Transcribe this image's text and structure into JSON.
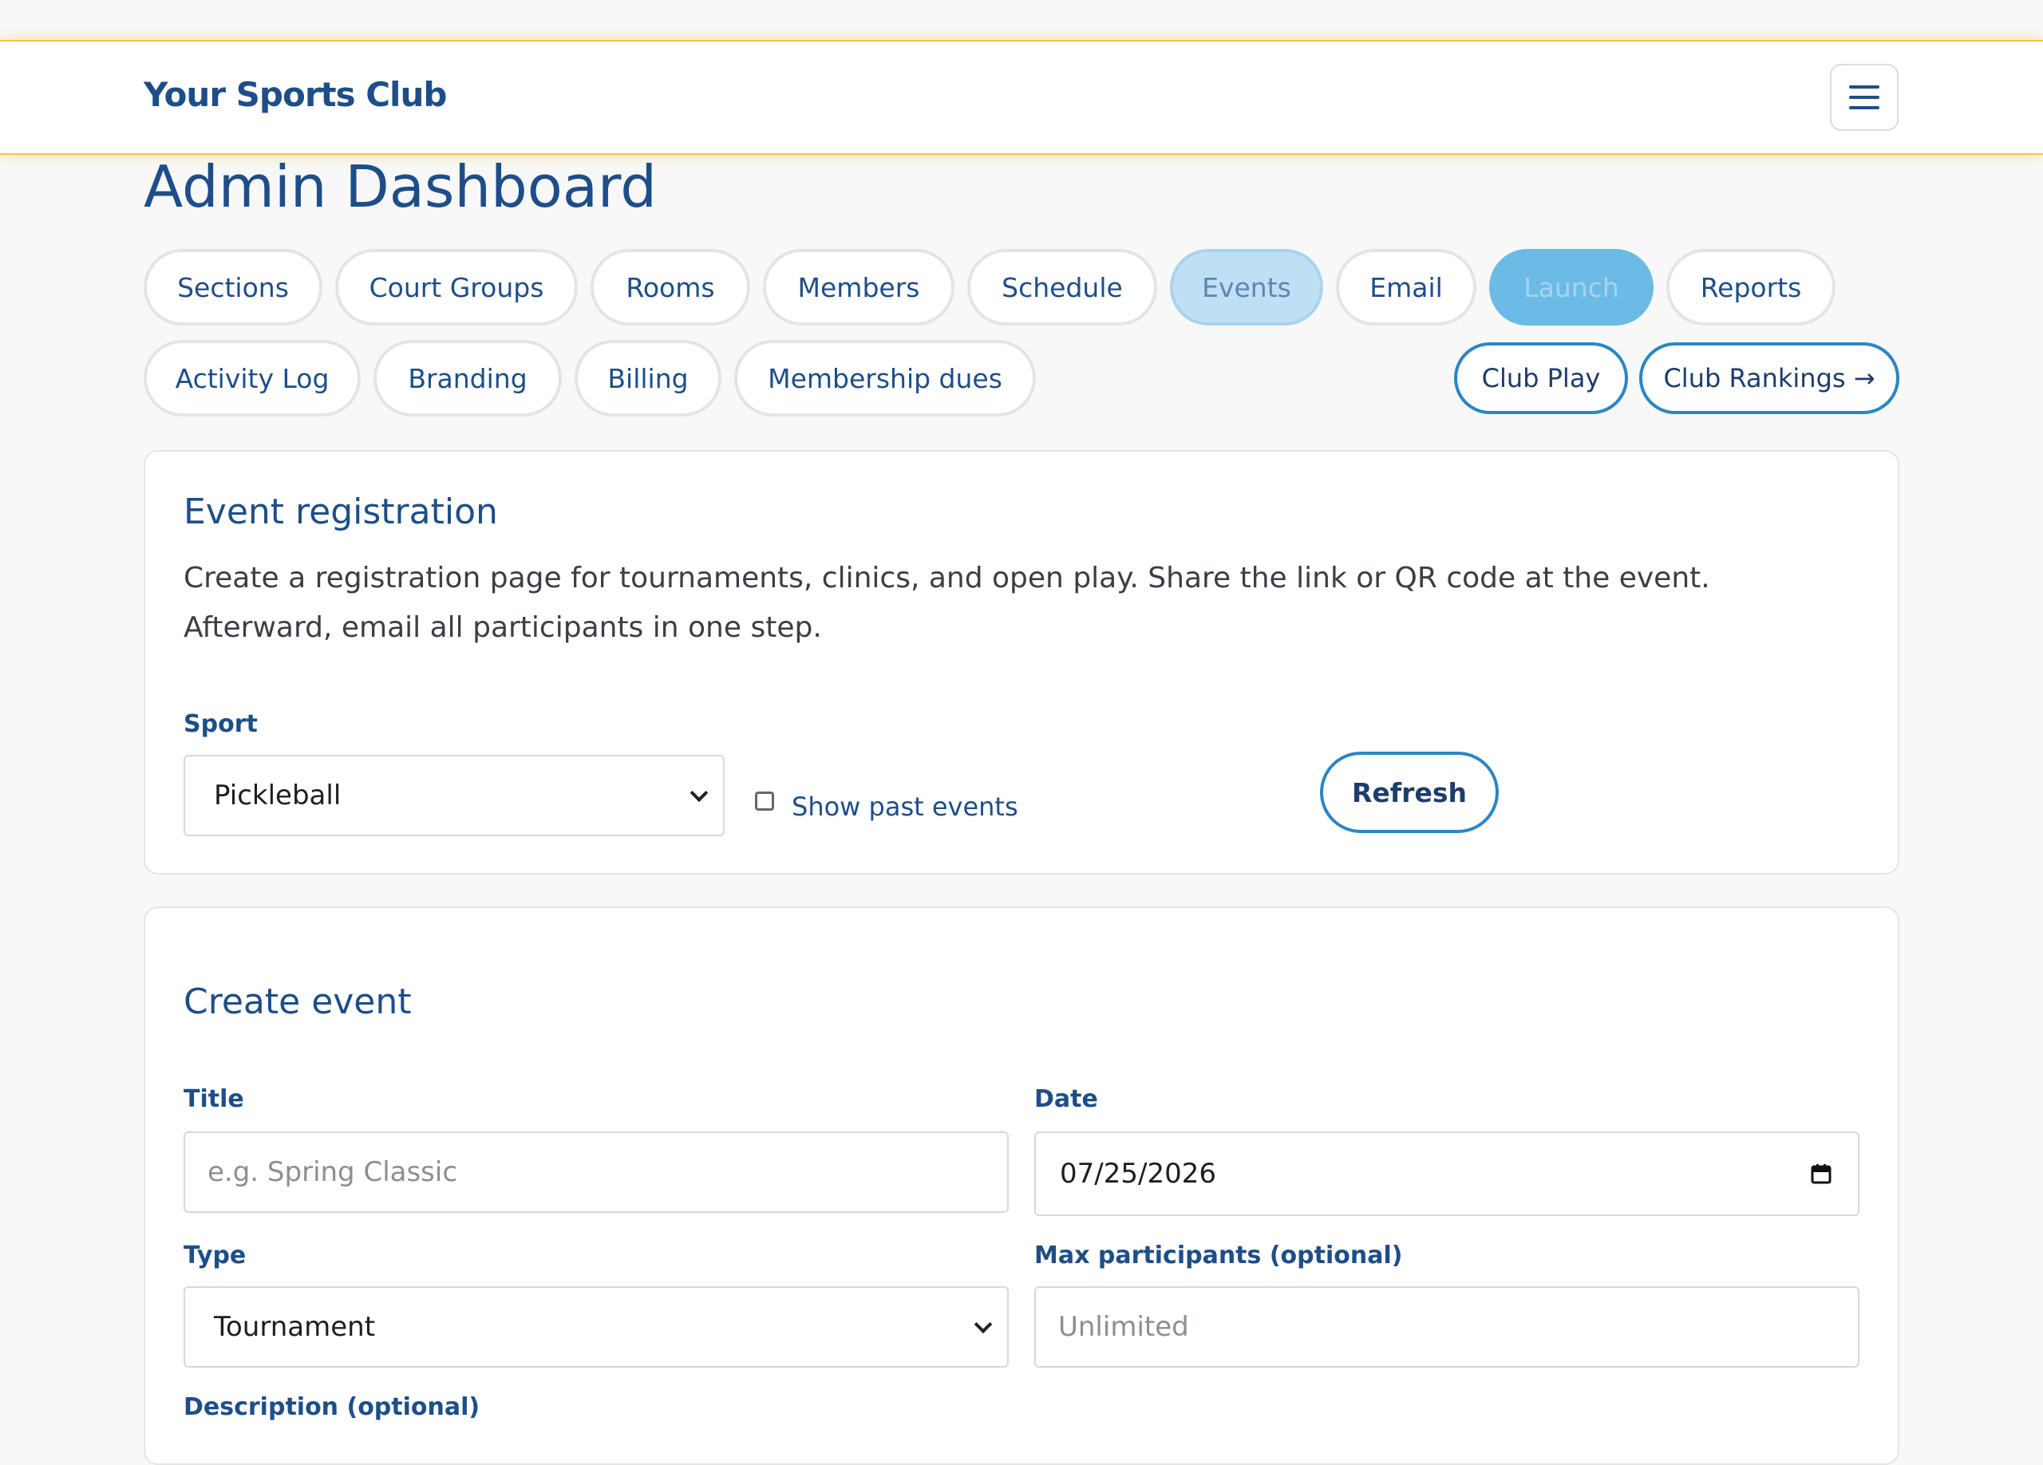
{
  "header": {
    "brand": "Your Sports Club",
    "menu_icon": "hamburger-menu-icon"
  },
  "page": {
    "title": "Admin Dashboard"
  },
  "nav": {
    "tabs": [
      {
        "label": "Sections"
      },
      {
        "label": "Court Groups"
      },
      {
        "label": "Rooms"
      },
      {
        "label": "Members"
      },
      {
        "label": "Schedule"
      },
      {
        "label": "Events",
        "state": "active"
      },
      {
        "label": "Email"
      },
      {
        "label": "Launch",
        "state": "highlight"
      },
      {
        "label": "Reports"
      },
      {
        "label": "Activity Log"
      },
      {
        "label": "Branding"
      },
      {
        "label": "Billing"
      },
      {
        "label": "Membership dues"
      }
    ],
    "club_play": "Club Play",
    "club_rankings": "Club Rankings →"
  },
  "registration": {
    "title": "Event registration",
    "description": "Create a registration page for tournaments, clinics, and open play. Share the link or QR code at the event. Afterward, email all participants in one step.",
    "sport_label": "Sport",
    "sport_value": "Pickleball",
    "show_past_label": "Show past events",
    "show_past_checked": false,
    "refresh_label": "Refresh"
  },
  "create": {
    "title": "Create event",
    "title_label": "Title",
    "title_placeholder": "e.g. Spring Classic",
    "date_label": "Date",
    "date_value": "07/25/2026",
    "type_label": "Type",
    "type_value": "Tournament",
    "max_label": "Max participants (optional)",
    "max_placeholder": "Unlimited",
    "description_label": "Description (optional)"
  },
  "colors": {
    "brand": "#1d4e89",
    "accent_border": "#f5c842",
    "active_tab": "#bfe0f4",
    "launch_tab": "#6cbbe6",
    "outline_button": "#2a86c4"
  }
}
